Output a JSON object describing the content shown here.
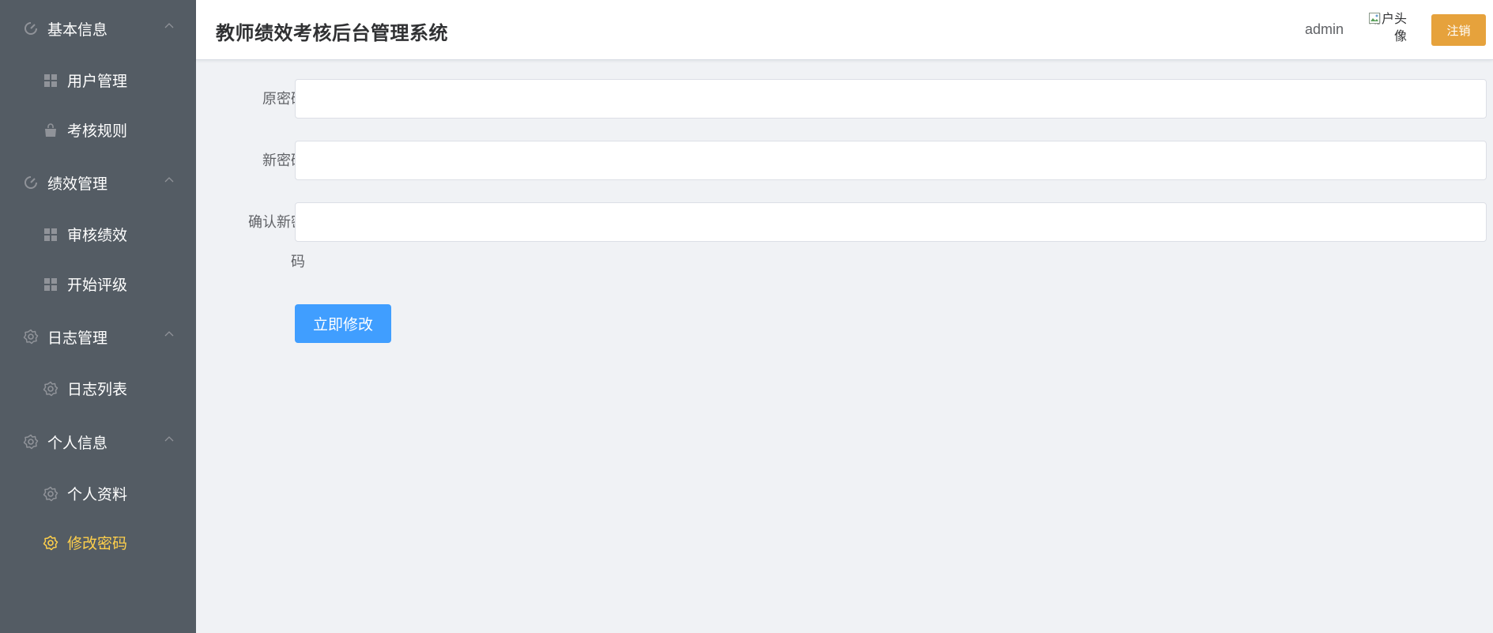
{
  "sidebar": {
    "groups": [
      {
        "label": "基本信息",
        "icon": "gauge-icon",
        "items": [
          {
            "label": "用户管理",
            "icon": "grid-icon"
          },
          {
            "label": "考核规则",
            "icon": "bag-icon"
          }
        ]
      },
      {
        "label": "绩效管理",
        "icon": "gauge-icon",
        "items": [
          {
            "label": "审核绩效",
            "icon": "grid-icon"
          },
          {
            "label": "开始评级",
            "icon": "grid-icon"
          }
        ]
      },
      {
        "label": "日志管理",
        "icon": "gear-icon",
        "items": [
          {
            "label": "日志列表",
            "icon": "gear-icon"
          }
        ]
      },
      {
        "label": "个人信息",
        "icon": "gear-icon",
        "items": [
          {
            "label": "个人资料",
            "icon": "gear-icon"
          },
          {
            "label": "修改密码",
            "icon": "gear-icon",
            "active": true
          }
        ]
      }
    ]
  },
  "header": {
    "title": "教师绩效考核后台管理系统",
    "username": "admin",
    "avatar_alt": "用户头像",
    "logout_label": "注销"
  },
  "form": {
    "old_password_label": "原密码",
    "new_password_label": "新密码",
    "confirm_password_label": "确认新密码",
    "old_password_value": "",
    "new_password_value": "",
    "confirm_password_value": "",
    "submit_label": "立即修改"
  },
  "colors": {
    "sidebar_bg": "#545c64",
    "active_text": "#ffd04b",
    "primary": "#409eff",
    "warning": "#e6a23c",
    "page_bg": "#f0f2f5"
  }
}
